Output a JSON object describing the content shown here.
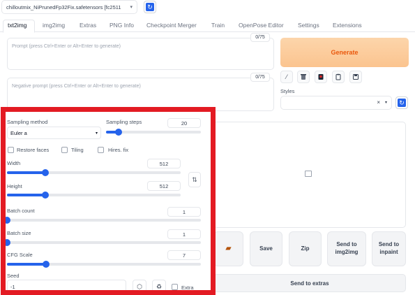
{
  "checkpoint": {
    "value": "chilloutmix_NiPrunedFp32Fix.safetensors [fc2511",
    "icon": "chevron-down-icon"
  },
  "tabs": [
    "txt2img",
    "img2img",
    "Extras",
    "PNG Info",
    "Checkpoint Merger",
    "Train",
    "OpenPose Editor",
    "Settings",
    "Extensions"
  ],
  "prompt": {
    "placeholder": "Prompt (press Ctrl+Enter or Alt+Enter to generate)",
    "counter": "0/75"
  },
  "negative_prompt": {
    "placeholder": "Negative prompt (press Ctrl+Enter or Alt+Enter to generate)",
    "counter": "0/75"
  },
  "generate_label": "Generate",
  "tools": [
    "pencil-icon",
    "trash-icon",
    "red-card-icon",
    "clipboard-icon",
    "save-icon"
  ],
  "styles": {
    "label": "Styles",
    "clear": "×",
    "caret": "▾"
  },
  "sampling_method": {
    "label": "Sampling method",
    "value": "Euler a"
  },
  "sampling_steps": {
    "label": "Sampling steps",
    "value": "20",
    "fraction": 0.13
  },
  "checkboxes": {
    "restore_faces": "Restore faces",
    "tiling": "Tiling",
    "hires_fix": "Hires. fix"
  },
  "width": {
    "label": "Width",
    "value": "512",
    "fraction": 0.22
  },
  "height": {
    "label": "Height",
    "value": "512",
    "fraction": 0.22
  },
  "swap_icon": "⇅",
  "batch_count": {
    "label": "Batch count",
    "value": "1",
    "fraction": 0.0
  },
  "batch_size": {
    "label": "Batch size",
    "value": "1",
    "fraction": 0.0
  },
  "cfg_scale": {
    "label": "CFG Scale",
    "value": "7",
    "fraction": 0.2
  },
  "seed": {
    "label": "Seed",
    "value": "-1",
    "extra_label": "Extra"
  },
  "actions": {
    "save": "Save",
    "zip": "Zip",
    "send_img2img": "Send to img2img",
    "send_inpaint": "Send to inpaint",
    "send_extras": "Send to extras"
  },
  "colors": {
    "accent": "#2563eb",
    "generate_text": "#ea580c",
    "highlight": "#e31b23"
  }
}
